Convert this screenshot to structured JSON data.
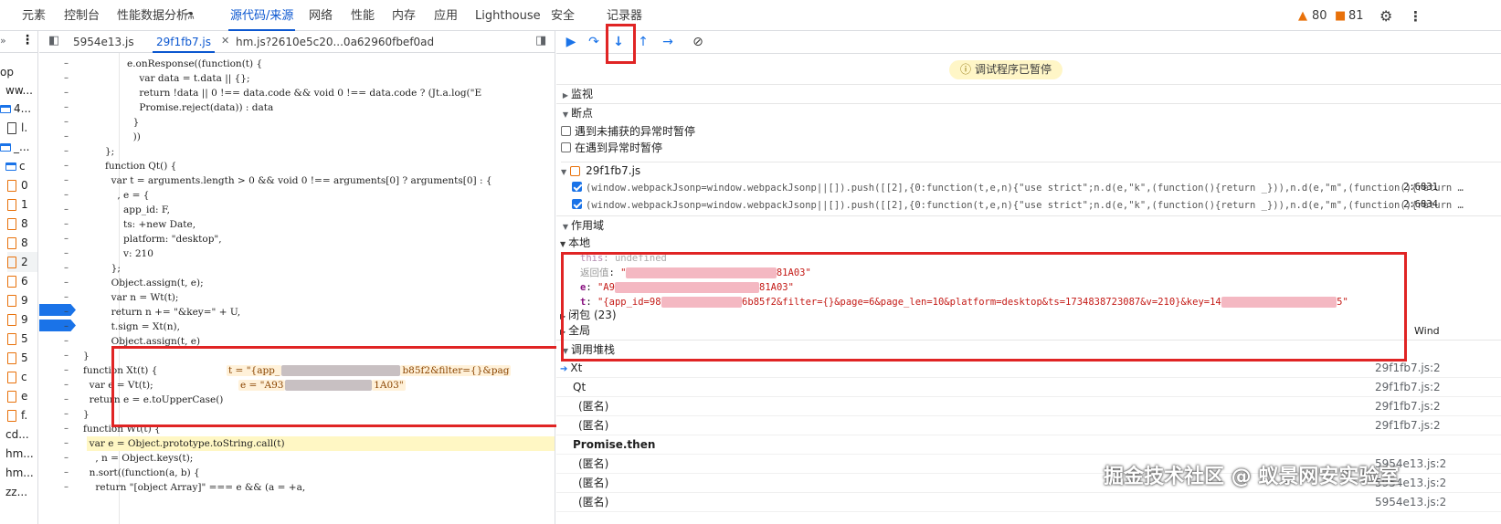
{
  "topbar": {
    "tabs": [
      "元素",
      "控制台",
      "性能数据分析",
      "源代码/来源",
      "网络",
      "性能",
      "内存",
      "应用",
      "Lighthouse",
      "安全",
      "记录器"
    ],
    "active_tab": "源代码/来源",
    "warnings": "80",
    "issues": "81"
  },
  "tree": {
    "rows": [
      "op",
      "ww...",
      "4...",
      "l.",
      "_...",
      "c",
      "0",
      "1",
      "8",
      "8",
      "2",
      "6",
      "9",
      "9",
      "5",
      "5",
      "c",
      "e",
      "f.",
      "cd...",
      "hm...",
      "hm...",
      "zz..."
    ]
  },
  "editor": {
    "tabs": [
      "5954e13.js",
      "29f1fb7.js",
      "hm.js?2610e5c20...0a62960fbef0ad"
    ],
    "active_tab": "29f1fb7.js",
    "lines": [
      {
        "t": "e.onResponse((function(t) {"
      },
      {
        "t": "    var data = t.data || {};"
      },
      {
        "t": "    return !data || 0 !== data.code && void 0 !== data.code ? (Jt.a.log(\"E"
      },
      {
        "t": "    Promise.reject(data)) : data"
      },
      {
        "t": "  }"
      },
      {
        "t": "  ))"
      },
      {
        "t": "};"
      },
      {
        "t": "function Qt() {"
      },
      {
        "t": "  var t = arguments.length > 0 && void 0 !== arguments[0] ? arguments[0] : {"
      },
      {
        "t": "    , e = {"
      },
      {
        "t": "      app_id: F,"
      },
      {
        "t": "      ts: +new Date,"
      },
      {
        "t": "      platform: \"desktop\","
      },
      {
        "t": "      v: 210"
      },
      {
        "t": "  };"
      },
      {
        "t": "  Object.assign(t, e);"
      },
      {
        "t": "  var n = Wt(t);"
      },
      {
        "t": "  return n += \"&key=\" + U,"
      },
      {
        "t": "  t.sign = Xt(n),"
      },
      {
        "t": "  Object.assign(t, e)"
      },
      {
        "t": "}"
      },
      {
        "t": "function Xt(t) {"
      },
      {
        "t": "  var e = Vt(t);"
      },
      {
        "t": "  return e = e.toUpperCase()"
      },
      {
        "t": "}"
      },
      {
        "t": "function Wt(t) {"
      },
      {
        "t": "  var e = Object.prototype.toString.call(t)"
      },
      {
        "t": "    , n = Object.keys(t);"
      },
      {
        "t": "  n.sort((function(a, b) {"
      },
      {
        "t": "    return \"[object Array]\" === e && (a = +a,"
      }
    ],
    "inline_t": "t = \"{app_",
    "inline_t_tail": "b85f2&filter={}&pag",
    "inline_e": "e = \"A93",
    "inline_e_tail": "1A03\""
  },
  "debugger": {
    "paused_label": "调试程序已暂停",
    "sections": {
      "watch": "监视",
      "breakpoints": "断点",
      "scope": "作用域",
      "callstack": "调用堆栈"
    },
    "pause_uncaught": "遇到未捕获的异常时暂停",
    "pause_caught": "在遇到异常时暂停",
    "bp_file": "29f1fb7.js",
    "bp_lines": [
      {
        "code": "(window.webpackJsonp=window.webpackJsonp||[]).push([[2],{0:function(t,e,n){\"use strict\";n.d(e,\"k\",(function(){return _})),n.d(e,\"m\",(function(){return …",
        "loc": "2:6831"
      },
      {
        "code": "(window.webpackJsonp=window.webpackJsonp||[]).push([[2],{0:function(t,e,n){\"use strict\";n.d(e,\"k\",(function(){return _})),n.d(e,\"m\",(function(){return …",
        "loc": "2:6834"
      }
    ],
    "local_label": "本地",
    "scope_this_key": "this",
    "scope_this_val": "undefined",
    "scope_ret_key": "返回值",
    "scope_ret_val_head": "\"",
    "scope_ret_val_tail": "81A03\"",
    "scope_e_key": "e",
    "scope_e_val_head": "\"A9",
    "scope_e_val_tail": "81A03\"",
    "scope_t_key": "t",
    "scope_t_val_head": "\"{app_id=98",
    "scope_t_val_mid": "6b85f2&filter={}&page=6&page_len=10&platform=desktop&ts=1734838723087&v=210}&key=14",
    "scope_t_val_tail": "5\"",
    "closure_label": "闭包 (23)",
    "global_label": "全局",
    "global_value": "Wind",
    "frames": [
      {
        "name": "Xt",
        "loc": "29f1fb7.js:2"
      },
      {
        "name": "Qt",
        "loc": "29f1fb7.js:2"
      },
      {
        "name": "(匿名)",
        "loc": "29f1fb7.js:2"
      },
      {
        "name": "(匿名)",
        "loc": "29f1fb7.js:2"
      },
      {
        "name": "Promise.then",
        "loc": ""
      },
      {
        "name": "(匿名)",
        "loc": "5954e13.js:2"
      },
      {
        "name": "(匿名)",
        "loc": "5954e13.js:2"
      },
      {
        "name": "(匿名)",
        "loc": "5954e13.js:2"
      }
    ]
  },
  "watermark": "掘金技术社区 @ 蚁景网安实验室"
}
